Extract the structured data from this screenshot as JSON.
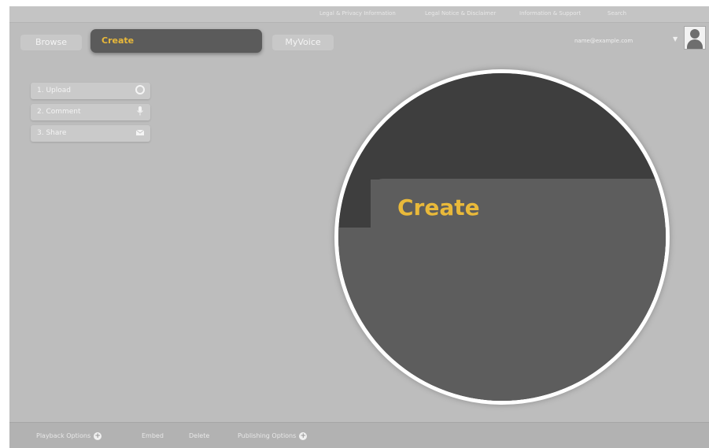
{
  "utility_links": [
    "Legal & Privacy Information",
    "Legal Notice & Disclaimer",
    "Information & Support",
    "Search"
  ],
  "nav": {
    "tabs": [
      {
        "label": "Browse"
      },
      {
        "label": "Create"
      },
      {
        "label": "MyVoice"
      }
    ],
    "user_email": "name@example.com",
    "user_menu_icon": "caret-down-icon",
    "avatar_icon": "user-avatar-icon"
  },
  "steps": [
    {
      "label": "1. Upload",
      "icon": "upload-icon"
    },
    {
      "label": "2. Comment",
      "icon": "microphone-icon"
    },
    {
      "label": "3. Share",
      "icon": "email-icon"
    }
  ],
  "magnifier": {
    "label": "Create"
  },
  "footer": {
    "links": [
      {
        "label": "Playback Options",
        "icon": "plus-circle-icon"
      },
      {
        "label": "Embed",
        "icon": ""
      },
      {
        "label": "Delete",
        "icon": ""
      },
      {
        "label": "Publishing Options",
        "icon": "plus-circle-icon"
      }
    ]
  },
  "colors": {
    "accent": "#e9b93a",
    "background": "#bdbdbd",
    "active_tab": "#5b5b5b",
    "magnifier_dark": "#3e3e3e",
    "magnifier_mid": "#5d5d5d"
  }
}
